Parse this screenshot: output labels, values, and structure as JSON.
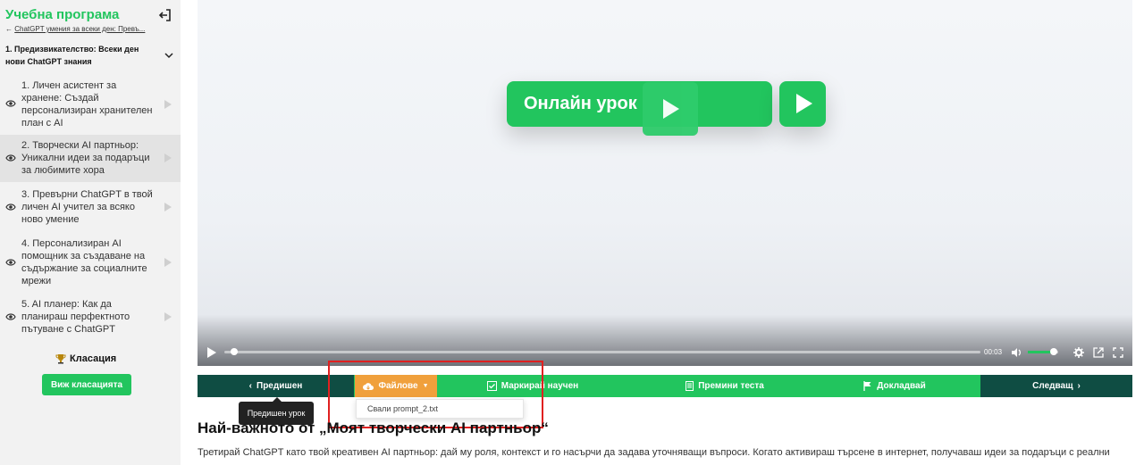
{
  "sidebar": {
    "title": "Учебна програма",
    "back_link": "ChatGPT умения за всеки ден: Превъ...",
    "section_title": "1. Предизвикателство: Всеки ден нови ChatGPT знания",
    "lessons": [
      {
        "label": "1. Личен асистент за хранене: Създай персонализиран хранителен план с AI"
      },
      {
        "label": "2. Творчески AI партньор: Уникални идеи за подаръци за любимите хора"
      },
      {
        "label": "3. Превърни ChatGPT в твой личен AI учител за всяко ново умение"
      },
      {
        "label": "4. Персонализиран AI помощник за създаване на съдържание за социалните мрежи"
      },
      {
        "label": "5. AI планер: Как да планираш перфектното пътуване с ChatGPT"
      }
    ],
    "ranking_title": "Класация",
    "ranking_button": "Виж класацията"
  },
  "video": {
    "banner_text": "Онлайн урок",
    "time": "00:03",
    "progress": 0.01,
    "volume": 0.85
  },
  "nav": {
    "prev": "Предишен",
    "files": "Файлове",
    "mark": "Маркирай научен",
    "test": "Премини теста",
    "report": "Докладвай",
    "next": "Следващ"
  },
  "tooltip": "Предишен урок",
  "files_menu": {
    "download": "Свали prompt_2.txt"
  },
  "content": {
    "heading": "Най-важното от „Моят творчески AI партньор“",
    "paragraph": "Третирай ChatGPT като твой креативен AI партньор: дай му роля, контекст и го насърчи да задава уточняващи въпроси. Когато активираш търсене в интернет, получаваш идеи за подаръци с реални"
  },
  "colors": {
    "accent": "#22c55e",
    "dark": "#0f4d43",
    "files": "#f0a03c",
    "highlight": "#e02020"
  }
}
